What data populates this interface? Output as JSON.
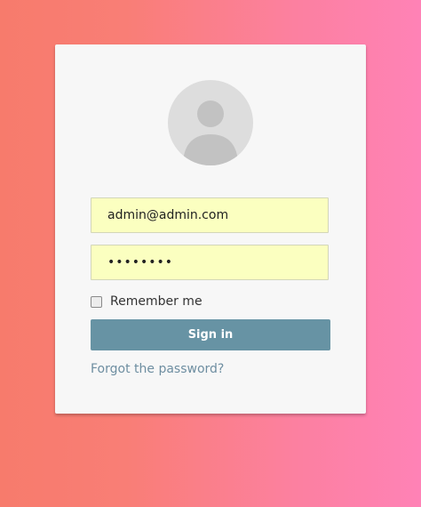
{
  "colors": {
    "background_left": "#f77b6c",
    "background_right": "#ff82b6",
    "card": "#f7f7f7",
    "input_fill": "#fbffc0",
    "button": "#6793a4",
    "link": "#6e8ea1"
  },
  "avatar": {
    "icon": "user-silhouette-icon"
  },
  "form": {
    "email_value": "admin@admin.com",
    "password_mask": "••••••••",
    "remember_label": "Remember me",
    "remember_checked": false,
    "signin_label": "Sign in",
    "forgot_label": "Forgot the password?"
  }
}
